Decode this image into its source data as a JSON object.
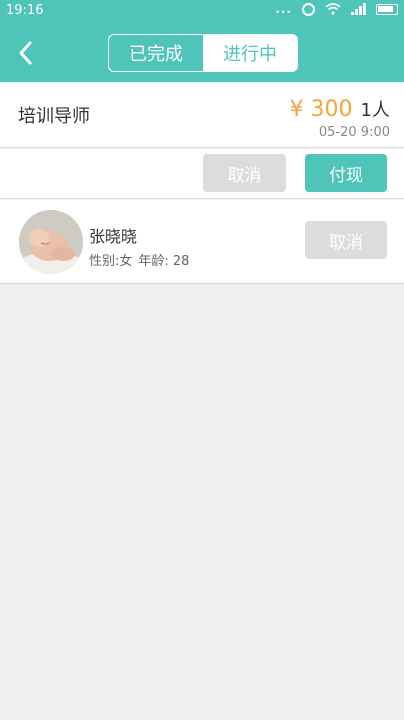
{
  "status_bar": {
    "time": "19:16",
    "dots": "...",
    "icons": [
      "alarm-icon",
      "wifi-icon",
      "signal-icon",
      "battery-icon"
    ]
  },
  "header": {
    "back_icon": "chevron-left-icon",
    "tabs": [
      {
        "label": "已完成",
        "active": false
      },
      {
        "label": "进行中",
        "active": true
      }
    ]
  },
  "order": {
    "title": "培训导师",
    "price": "¥ 300",
    "count": "1人",
    "date": "05-20 9:00"
  },
  "actions": {
    "cancel_label": "取消",
    "pay_label": "付现"
  },
  "member": {
    "name": "张晓晓",
    "gender": "性别:女",
    "age": "年龄: 28",
    "cancel_label": "取消"
  },
  "colors": {
    "accent": "#4ec5b8",
    "price": "#f4a43a",
    "disabled": "#dcdcdc",
    "background": "#efefef"
  }
}
